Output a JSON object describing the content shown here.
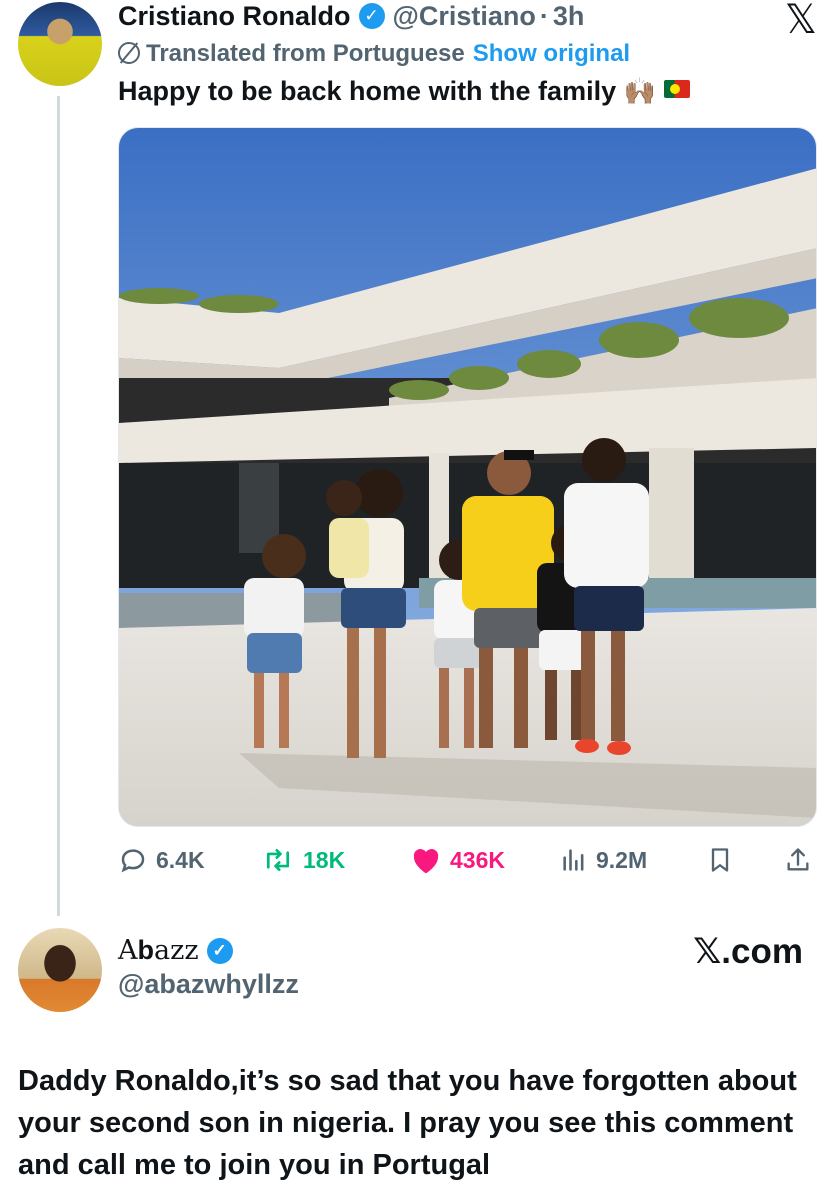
{
  "post": {
    "author_name": "Cristiano Ronaldo",
    "handle": "@Cristiano",
    "separator": "·",
    "time": "3h",
    "translated_label": "Translated from Portuguese",
    "show_original": "Show original",
    "text": "Happy to be back home with the family",
    "emoji_hands": "🙌🏽",
    "close_icon": "x-logo",
    "verified_icon": "verified-badge",
    "image_alt_icon": "family-photo"
  },
  "actions": {
    "replies": "6.4K",
    "retweets": "18K",
    "likes": "436K",
    "views": "9.2M"
  },
  "comment": {
    "author_name_prefix": "A",
    "author_name_bold": "b",
    "author_name_rest": "azz",
    "handle": "@abazwhyllzz",
    "watermark": "𝕏.com",
    "text": "Daddy Ronaldo,it’s so sad that you have forgotten about your second son in nigeria. I pray you see this comment and call me to join you in Portugal"
  },
  "colors": {
    "accent_blue": "#1d9bf0",
    "retweet_green": "#00ba7c",
    "like_pink": "#f91880",
    "muted_gray": "#536471"
  }
}
